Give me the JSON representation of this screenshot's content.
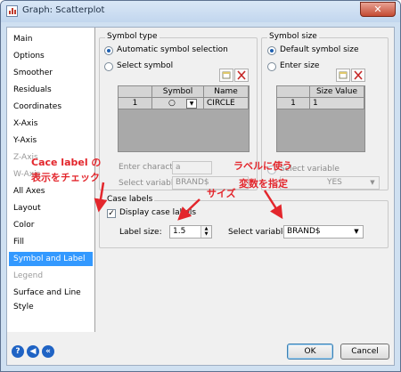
{
  "window": {
    "title": "Graph: Scatterplot",
    "close_glyph": "✕"
  },
  "sidebar": {
    "items": [
      {
        "label": "Main",
        "state": "normal"
      },
      {
        "label": "Options",
        "state": "normal"
      },
      {
        "label": "Smoother",
        "state": "normal"
      },
      {
        "label": "Residuals",
        "state": "normal"
      },
      {
        "label": "Coordinates",
        "state": "normal"
      },
      {
        "label": "X-Axis",
        "state": "normal"
      },
      {
        "label": "Y-Axis",
        "state": "normal"
      },
      {
        "label": "Z-Axis",
        "state": "disabled"
      },
      {
        "label": "W-Axis",
        "state": "disabled"
      },
      {
        "label": "All Axes",
        "state": "normal"
      },
      {
        "label": "Layout",
        "state": "normal"
      },
      {
        "label": "Color",
        "state": "normal"
      },
      {
        "label": "Fill",
        "state": "normal"
      },
      {
        "label": "Symbol and Label",
        "state": "selected"
      },
      {
        "label": "Legend",
        "state": "disabled"
      },
      {
        "label": "Surface and Line Style",
        "state": "normal"
      }
    ]
  },
  "symbol_type": {
    "title": "Symbol type",
    "auto_label": "Automatic symbol selection",
    "select_label": "Select symbol",
    "selected": "auto",
    "table": {
      "col_symbol": "Symbol",
      "col_name": "Name",
      "row_index": "1",
      "symbol_glyph": "○",
      "name": "CIRCLE"
    },
    "enter_char_label": "Enter character",
    "enter_char_value": "a",
    "select_var_label": "Select variable",
    "select_var_value": "BRAND$"
  },
  "symbol_size": {
    "title": "Symbol size",
    "default_label": "Default symbol size",
    "enter_label": "Enter size",
    "selected": "default",
    "table": {
      "col_size": "Size Value",
      "row_index": "1",
      "value": "1"
    },
    "select_var_label": "Select variable",
    "select_var_value": "YES"
  },
  "case_labels": {
    "title": "Case labels",
    "display_label": "Display case labels",
    "display_checked": true,
    "check_glyph": "✓",
    "size_label": "Label size:",
    "size_value": "1.5",
    "select_var_label": "Select variable:",
    "select_var_value": "BRAND$"
  },
  "footer": {
    "ok": "OK",
    "cancel": "Cancel",
    "help_glyph": "?",
    "back_glyph": "◀",
    "first_glyph": "«"
  },
  "annotations": {
    "a1_line1": "Cace label の",
    "a1_line2": "表示をチェック",
    "a2": "サイズ",
    "a3_line1": "ラベルに使う",
    "a3_line2": "変数を指定",
    "color": "#e3262c"
  }
}
